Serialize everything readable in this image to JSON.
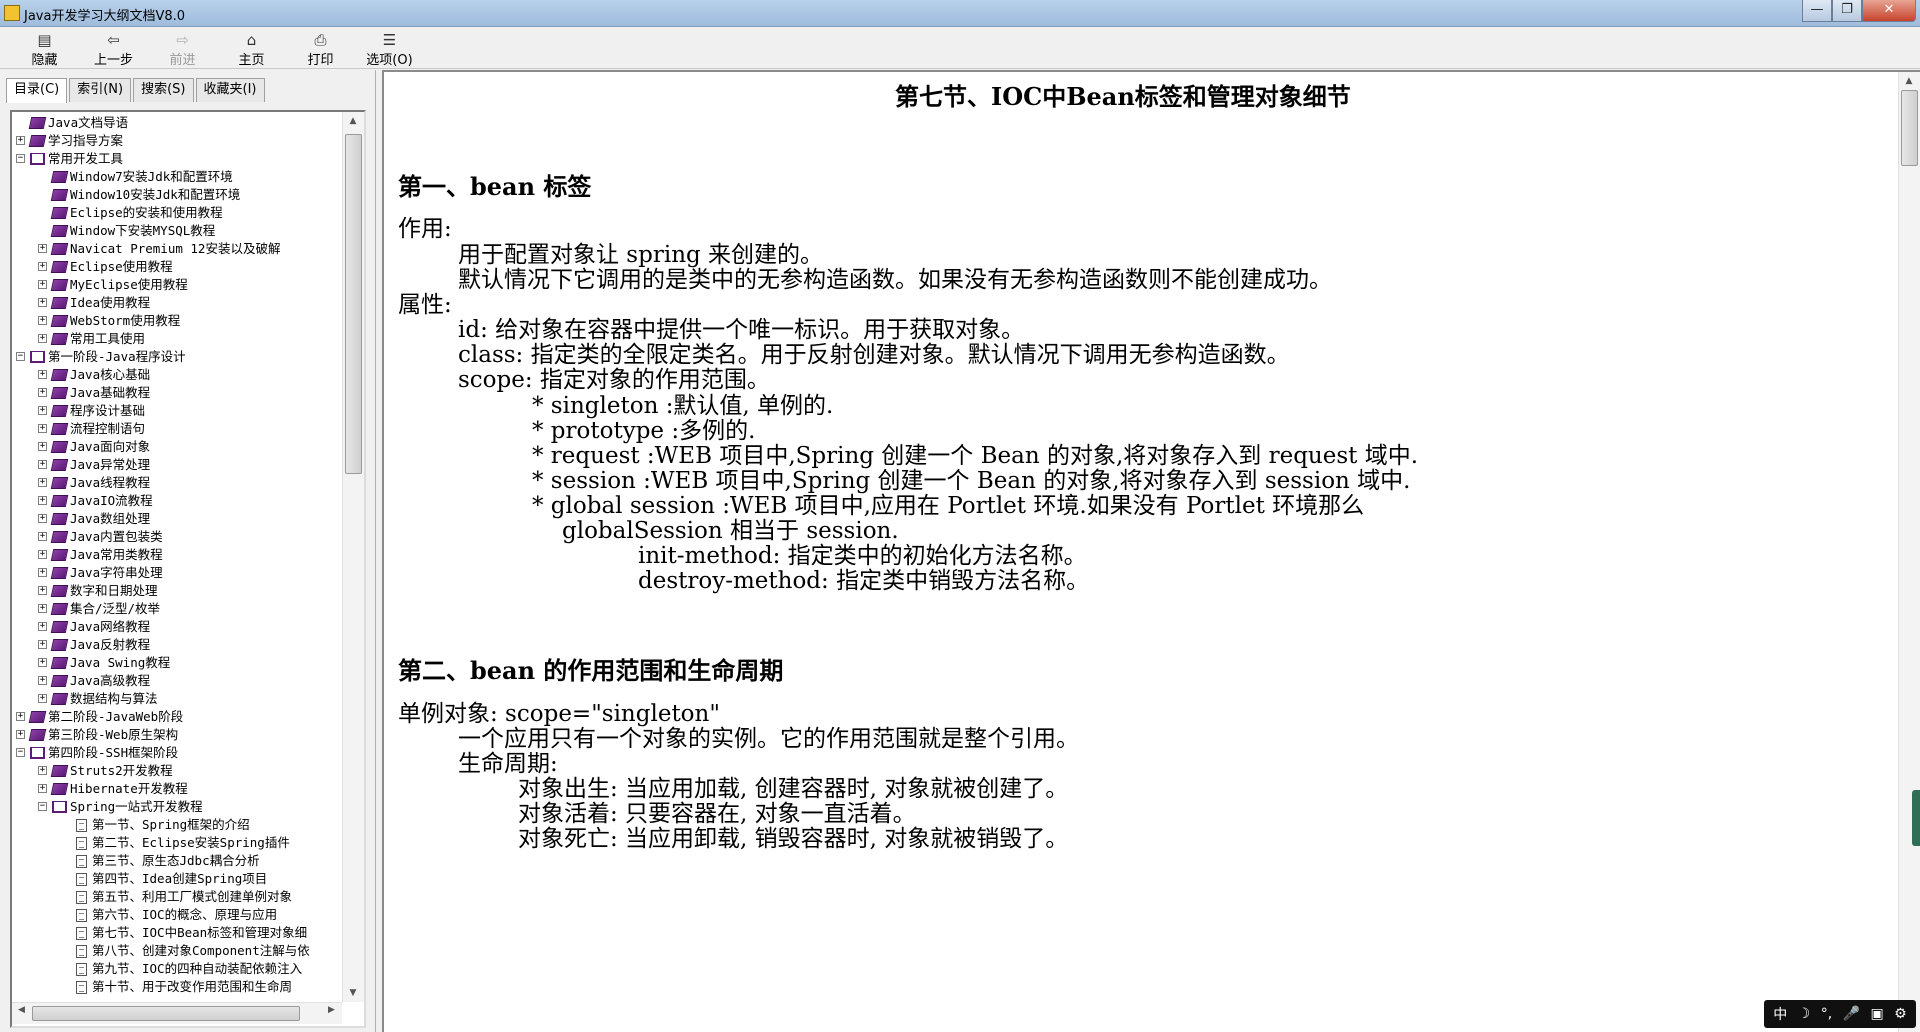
{
  "window": {
    "title": "Java开发学习大纲文档V8.0",
    "btn_min": "—",
    "btn_max": "❐",
    "btn_close": "✕"
  },
  "toolbar": {
    "hide": "隐藏",
    "back": "上一步",
    "forward": "前进",
    "home": "主页",
    "print": "打印",
    "options": "选项(O)"
  },
  "tabs": {
    "contents": "目录(C)",
    "index": "索引(N)",
    "search": "搜索(S)",
    "favorites": "收藏夹(I)"
  },
  "tree": [
    {
      "label": "Java文档导语",
      "expander": "",
      "icon": "closed",
      "level": 1
    },
    {
      "label": "学习指导方案",
      "expander": "+",
      "icon": "closed",
      "level": 1
    },
    {
      "label": "常用开发工具",
      "expander": "−",
      "icon": "open",
      "level": 1
    },
    {
      "label": "Window7安装Jdk和配置环境",
      "expander": "",
      "icon": "closed",
      "level": 2
    },
    {
      "label": "Window10安装Jdk和配置环境",
      "expander": "",
      "icon": "closed",
      "level": 2
    },
    {
      "label": "Eclipse的安装和使用教程",
      "expander": "",
      "icon": "closed",
      "level": 2
    },
    {
      "label": "Window下安装MYSQL教程",
      "expander": "",
      "icon": "closed",
      "level": 2
    },
    {
      "label": "Navicat Premium 12安装以及破解",
      "expander": "+",
      "icon": "closed",
      "level": 2
    },
    {
      "label": "Eclipse使用教程",
      "expander": "+",
      "icon": "closed",
      "level": 2
    },
    {
      "label": "MyEclipse使用教程",
      "expander": "+",
      "icon": "closed",
      "level": 2
    },
    {
      "label": "Idea使用教程",
      "expander": "+",
      "icon": "closed",
      "level": 2
    },
    {
      "label": "WebStorm使用教程",
      "expander": "+",
      "icon": "closed",
      "level": 2
    },
    {
      "label": "常用工具使用",
      "expander": "+",
      "icon": "closed",
      "level": 2
    },
    {
      "label": "第一阶段-Java程序设计",
      "expander": "−",
      "icon": "open",
      "level": 1
    },
    {
      "label": "Java核心基础",
      "expander": "+",
      "icon": "closed",
      "level": 2
    },
    {
      "label": "Java基础教程",
      "expander": "+",
      "icon": "closed",
      "level": 2
    },
    {
      "label": "程序设计基础",
      "expander": "+",
      "icon": "closed",
      "level": 2
    },
    {
      "label": "流程控制语句",
      "expander": "+",
      "icon": "closed",
      "level": 2
    },
    {
      "label": "Java面向对象",
      "expander": "+",
      "icon": "closed",
      "level": 2
    },
    {
      "label": "Java异常处理",
      "expander": "+",
      "icon": "closed",
      "level": 2
    },
    {
      "label": "Java线程教程",
      "expander": "+",
      "icon": "closed",
      "level": 2
    },
    {
      "label": "JavaIO流教程",
      "expander": "+",
      "icon": "closed",
      "level": 2
    },
    {
      "label": "Java数组处理",
      "expander": "+",
      "icon": "closed",
      "level": 2
    },
    {
      "label": "Java内置包装类",
      "expander": "+",
      "icon": "closed",
      "level": 2
    },
    {
      "label": "Java常用类教程",
      "expander": "+",
      "icon": "closed",
      "level": 2
    },
    {
      "label": "Java字符串处理",
      "expander": "+",
      "icon": "closed",
      "level": 2
    },
    {
      "label": "数字和日期处理",
      "expander": "+",
      "icon": "closed",
      "level": 2
    },
    {
      "label": "集合/泛型/枚举",
      "expander": "+",
      "icon": "closed",
      "level": 2
    },
    {
      "label": "Java网络教程",
      "expander": "+",
      "icon": "closed",
      "level": 2
    },
    {
      "label": "Java反射教程",
      "expander": "+",
      "icon": "closed",
      "level": 2
    },
    {
      "label": "Java Swing教程",
      "expander": "+",
      "icon": "closed",
      "level": 2
    },
    {
      "label": "Java高级教程",
      "expander": "+",
      "icon": "closed",
      "level": 2
    },
    {
      "label": "数据结构与算法",
      "expander": "+",
      "icon": "closed",
      "level": 2
    },
    {
      "label": "第二阶段-JavaWeb阶段",
      "expander": "+",
      "icon": "closed",
      "level": 1
    },
    {
      "label": "第三阶段-Web原生架构",
      "expander": "+",
      "icon": "closed",
      "level": 1
    },
    {
      "label": "第四阶段-SSH框架阶段",
      "expander": "−",
      "icon": "open",
      "level": 1
    },
    {
      "label": "Struts2开发教程",
      "expander": "+",
      "icon": "closed",
      "level": 2
    },
    {
      "label": "Hibernate开发教程",
      "expander": "+",
      "icon": "closed",
      "level": 2
    },
    {
      "label": "Spring一站式开发教程",
      "expander": "−",
      "icon": "open",
      "level": 2
    },
    {
      "label": "第一节、Spring框架的介绍",
      "expander": "",
      "icon": "page",
      "level": 3
    },
    {
      "label": "第二节、Eclipse安装Spring插件",
      "expander": "",
      "icon": "page",
      "level": 3
    },
    {
      "label": "第三节、原生态Jdbc耦合分析",
      "expander": "",
      "icon": "page",
      "level": 3
    },
    {
      "label": "第四节、Idea创建Spring项目",
      "expander": "",
      "icon": "page",
      "level": 3
    },
    {
      "label": "第五节、利用工厂模式创建单例对象",
      "expander": "",
      "icon": "page",
      "level": 3
    },
    {
      "label": "第六节、IOC的概念、原理与应用",
      "expander": "",
      "icon": "page",
      "level": 3
    },
    {
      "label": "第七节、IOC中Bean标签和管理对象细",
      "expander": "",
      "icon": "page",
      "level": 3
    },
    {
      "label": "第八节、创建对象Component注解与依",
      "expander": "",
      "icon": "page",
      "level": 3
    },
    {
      "label": "第九节、IOC的四种自动装配依赖注入",
      "expander": "",
      "icon": "page",
      "level": 3
    },
    {
      "label": "第十节、用于改变作用范围和生命周",
      "expander": "",
      "icon": "page",
      "level": 3
    }
  ],
  "content": {
    "title": "第七节、IOC中Bean标签和管理对象细节",
    "lines": [
      {
        "text": "第一、bean 标签",
        "kind": "h2"
      },
      {
        "text": "作用:",
        "kind": "p"
      },
      {
        "text": "用于配置对象让 spring 来创建的。",
        "kind": "p"
      },
      {
        "text": "默认情况下它调用的是类中的无参构造函数。如果没有无参构造函数则不能创建成功。",
        "kind": "p"
      },
      {
        "text": "属性:",
        "kind": "p"
      },
      {
        "text": "id: 给对象在容器中提供一个唯一标识。用于获取对象。",
        "kind": "p"
      },
      {
        "text": "class: 指定类的全限定类名。用于反射创建对象。默认情况下调用无参构造函数。",
        "kind": "p"
      },
      {
        "text": "scope: 指定对象的作用范围。",
        "kind": "p"
      },
      {
        "text": "* singleton :默认值, 单例的.",
        "kind": "p"
      },
      {
        "text": "* prototype :多例的.",
        "kind": "p"
      },
      {
        "text": "* request :WEB 项目中,Spring 创建一个 Bean 的对象,将对象存入到 request 域中.",
        "kind": "p"
      },
      {
        "text": "* session :WEB 项目中,Spring 创建一个 Bean 的对象,将对象存入到 session 域中.",
        "kind": "p"
      },
      {
        "text": "* global session :WEB 项目中,应用在 Portlet 环境.如果没有 Portlet 环境那么",
        "kind": "p"
      },
      {
        "text": "globalSession 相当于 session.",
        "kind": "p"
      },
      {
        "text": "init-method: 指定类中的初始化方法名称。",
        "kind": "p"
      },
      {
        "text": "destroy-method: 指定类中销毁方法名称。",
        "kind": "p"
      },
      {
        "text": "第二、bean 的作用范围和生命周期",
        "kind": "h2"
      },
      {
        "text": "单例对象: scope=\"singleton\"",
        "kind": "p"
      },
      {
        "text": "一个应用只有一个对象的实例。它的作用范围就是整个引用。",
        "kind": "p"
      },
      {
        "text": "生命周期:",
        "kind": "p"
      },
      {
        "text": "对象出生: 当应用加载, 创建容器时, 对象就被创建了。",
        "kind": "p"
      },
      {
        "text": "对象活着: 只要容器在, 对象一直活着。",
        "kind": "p"
      },
      {
        "text": "对象死亡: 当应用卸载, 销毁容器时, 对象就被销毁了。",
        "kind": "p"
      }
    ]
  },
  "ime": [
    "中",
    "☽",
    "°,",
    "🎤",
    "▣",
    "⚙"
  ]
}
